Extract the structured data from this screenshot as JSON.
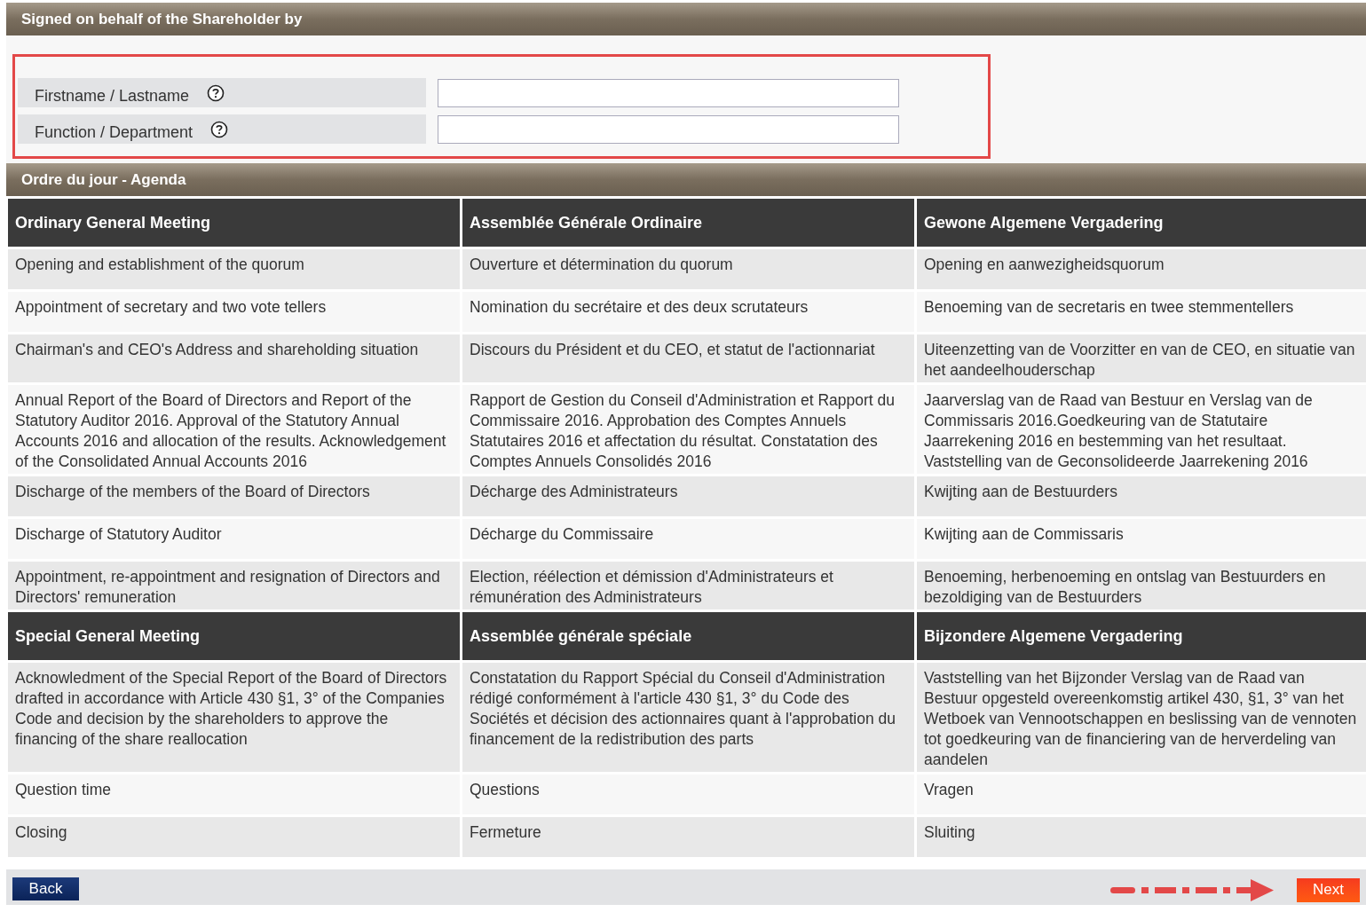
{
  "signer_section": {
    "title": "Signed on behalf of the Shareholder by",
    "fields": [
      {
        "label": "Firstname / Lastname"
      },
      {
        "label": "Function / Department"
      }
    ]
  },
  "agenda_section": {
    "title": "Ordre du jour - Agenda",
    "blocks": [
      {
        "headers": [
          "Ordinary General Meeting",
          "Assemblée Générale Ordinaire",
          "Gewone Algemene Vergadering"
        ],
        "rows": [
          [
            "Opening and establishment of the quorum",
            "Ouverture et détermination du quorum",
            "Opening en aanwezigheidsquorum"
          ],
          [
            "Appointment of secretary and two vote tellers",
            "Nomination du secrétaire et des deux scrutateurs",
            "Benoeming van de secretaris en twee stemmentellers"
          ],
          [
            "Chairman's and CEO's Address and shareholding situation",
            "Discours du Président et du CEO, et statut de l'actionnariat",
            "Uiteenzetting van de Voorzitter en van de CEO, en situatie van het aandeelhouderschap"
          ],
          [
            "Annual Report of the Board of Directors and Report of the Statutory Auditor 2016. Approval of the Statutory Annual Accounts 2016 and allocation of the results. Acknowledgement of the Consolidated Annual Accounts 2016",
            "Rapport de Gestion du Conseil d'Administration et Rapport du Commissaire 2016. Approbation des Comptes Annuels Statutaires 2016 et affectation du résultat. Constatation des Comptes Annuels Consolidés 2016",
            "Jaarverslag van de Raad van Bestuur en Verslag van de Commissaris 2016.Goedkeuring van de Statutaire Jaarrekening 2016 en bestemming van het resultaat. Vaststelling van de Geconsolideerde Jaarrekening 2016"
          ],
          [
            "Discharge of the members of the Board of Directors",
            "Décharge des Administrateurs",
            "Kwijting aan de Bestuurders"
          ],
          [
            "Discharge of Statutory Auditor",
            "Décharge du Commissaire",
            "Kwijting aan de Commissaris"
          ],
          [
            "Appointment, re-appointment and resignation of Directors and Directors' remuneration",
            "Election, réélection et démission d'Administrateurs et rémunération des Administrateurs",
            "Benoeming, herbenoeming en ontslag van Bestuurders en bezoldiging van de Bestuurders"
          ]
        ]
      },
      {
        "headers": [
          "Special General Meeting",
          "Assemblée générale spéciale",
          "Bijzondere Algemene Vergadering"
        ],
        "rows": [
          [
            "Acknowledment of the Special Report of the Board of Directors drafted in accordance with Article 430 §1, 3° of the Companies Code and decision by the shareholders to approve the financing of the share reallocation",
            "Constatation du Rapport Spécial du Conseil d'Administration rédigé conformément à l'article 430 §1, 3° du Code des Sociétés et décision des actionnaires quant à l'approbation du financement de la redistribution des parts",
            "Vaststelling van het Bijzonder Verslag van de Raad van Bestuur opgesteld overeenkomstig artikel 430, §1, 3° van het Wetboek van Vennootschappen en beslissing van de vennoten tot goedkeuring van de financiering van de herverdeling van aandelen"
          ],
          [
            "Question time",
            "Questions",
            "Vragen"
          ],
          [
            "Closing",
            "Fermeture",
            "Sluiting"
          ]
        ]
      }
    ]
  },
  "buttons": {
    "back": "Back",
    "next": "Next"
  }
}
